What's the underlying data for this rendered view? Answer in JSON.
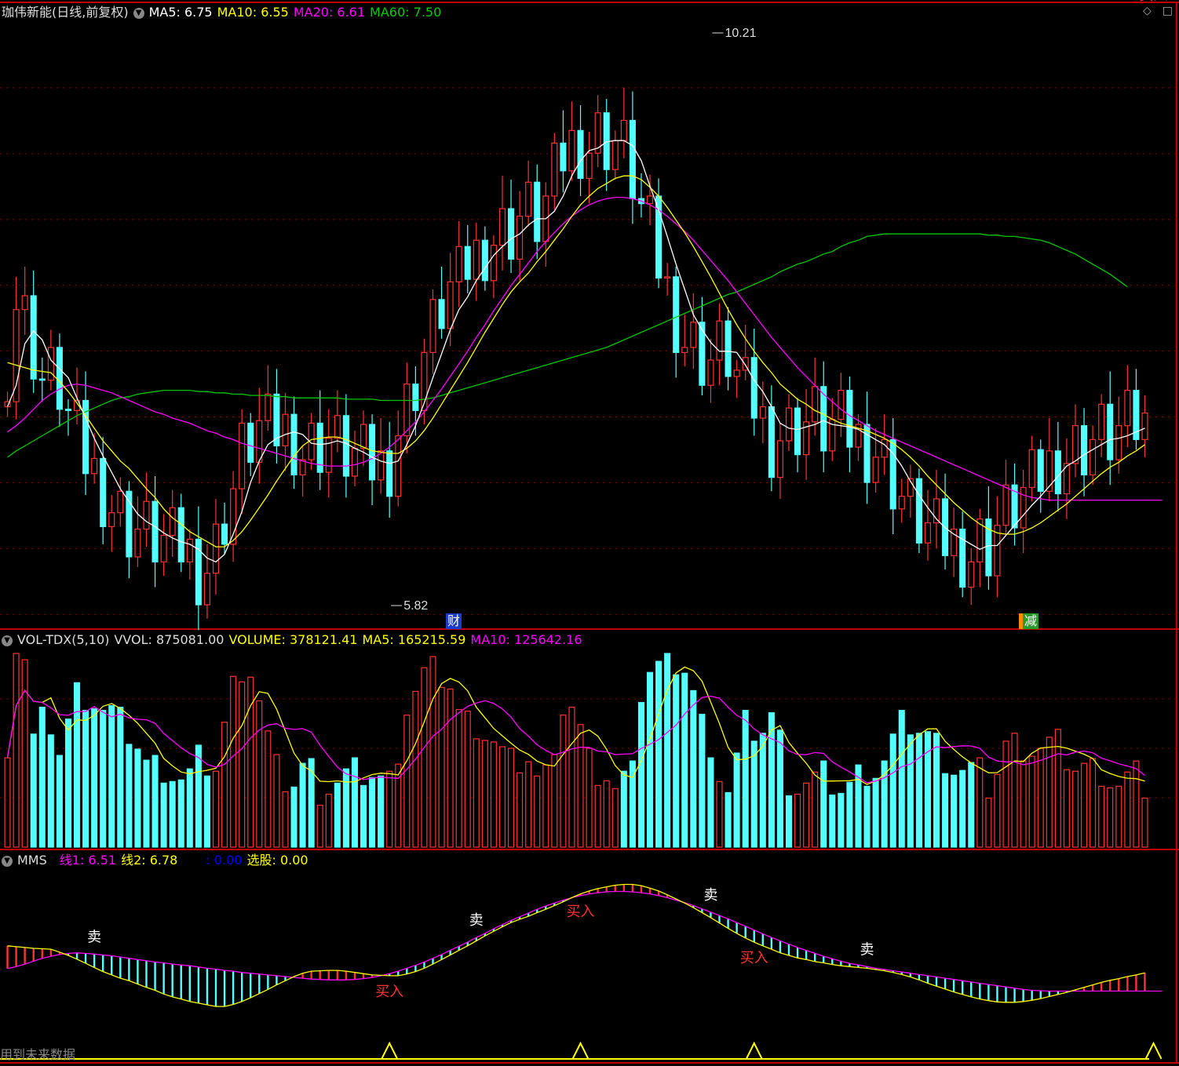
{
  "main_header": {
    "stock": "珈伟新能(日线,前复权)",
    "ma5": "MA5: 6.75",
    "ma10": "MA10: 6.55",
    "ma20": "MA20: 6.61",
    "ma60": "MA60: 7.50"
  },
  "vol_header": {
    "name": "VOL-TDX(5,10)",
    "vvol": "VVOL: 875081.00",
    "volume": "VOLUME: 378121.41",
    "ma5": "MA5: 165215.59",
    "ma10": "MA10: 125642.16"
  },
  "mms_header": {
    "name": "MMS",
    "line1": "线1: 6.51",
    "line2": "线2: 6.78",
    "blank": ": 0.00",
    "select": "选股: 0.00"
  },
  "markers": {
    "high_label": "10.21",
    "low_label": "5.82",
    "cai_badge": "财",
    "jian_badge": "减",
    "sell_label": "卖",
    "buy_label": "买入"
  },
  "footer_text": "用到未来数据",
  "window_icons": [
    "diamond-icon",
    "square-icon"
  ],
  "colors": {
    "up": "#ff3232",
    "down": "#54ffff",
    "ma5": "#ffffff",
    "ma10": "#ffff00",
    "ma20": "#ff00ff",
    "ma60": "#00c800",
    "grid": "#8b0000",
    "border": "#c00000"
  },
  "chart_data": [
    {
      "type": "candlestick",
      "title": "珈伟新能(日线,前复权)",
      "ylim": [
        5.6,
        10.4
      ],
      "annotations": [
        {
          "label": "10.21",
          "kind": "high",
          "index": 81
        },
        {
          "label": "5.82",
          "kind": "low",
          "index": 44
        }
      ],
      "series": [
        {
          "name": "MA5",
          "values": [
            7.35,
            7.52,
            7.85,
            7.95,
            7.88,
            7.72,
            7.65,
            7.58,
            7.42,
            7.26,
            7.1,
            6.96,
            6.83,
            6.7,
            6.6,
            6.5,
            6.44,
            6.4,
            6.35,
            6.31,
            6.28,
            6.26,
            6.22,
            6.15,
            6.12,
            6.18,
            6.34,
            6.52,
            6.75,
            6.92,
            7.05,
            7.1,
            7.13,
            7.15,
            7.13,
            7.06,
            7.05,
            7.06,
            7.08,
            7.06,
            7.02,
            6.99,
            6.95,
            6.92,
            6.9,
            6.92,
            7.05,
            7.2,
            7.38,
            7.58,
            7.77,
            7.96,
            8.12,
            8.22,
            8.35,
            8.45,
            8.55,
            8.62,
            8.68,
            8.72,
            8.79,
            8.84,
            8.84,
            8.9,
            9.02,
            9.18,
            9.3,
            9.38,
            9.4,
            9.45,
            9.46,
            9.46,
            9.42,
            9.3,
            9.1,
            8.91,
            8.7,
            8.48,
            8.28,
            8.08,
            7.96,
            7.86,
            7.79,
            7.79,
            7.78,
            7.68,
            7.56,
            7.47,
            7.35,
            7.22,
            7.18,
            7.17,
            7.19,
            7.21,
            7.24,
            7.21,
            7.2,
            7.19,
            7.17,
            7.13,
            7.09,
            7.05,
            6.98,
            6.88,
            6.76,
            6.65,
            6.55,
            6.46,
            6.39,
            6.34,
            6.3,
            6.26,
            6.22,
            6.25,
            6.25,
            6.33,
            6.41,
            6.49,
            6.57,
            6.64,
            6.72,
            6.8,
            6.88,
            6.92,
            6.97,
            7.01,
            7.05,
            7.09,
            7.1,
            7.12,
            7.15,
            7.18
          ]
        },
        {
          "name": "MA10",
          "values": [
            7.7,
            7.68,
            7.66,
            7.64,
            7.63,
            7.62,
            7.55,
            7.47,
            7.38,
            7.28,
            7.18,
            7.08,
            7.0,
            6.92,
            6.86,
            6.78,
            6.7,
            6.63,
            6.54,
            6.47,
            6.42,
            6.36,
            6.32,
            6.28,
            6.24,
            6.24,
            6.29,
            6.36,
            6.45,
            6.55,
            6.65,
            6.76,
            6.86,
            6.96,
            7.04,
            7.09,
            7.1,
            7.11,
            7.11,
            7.09,
            7.06,
            7.03,
            7.0,
            6.99,
            6.98,
            6.98,
            7.02,
            7.08,
            7.16,
            7.26,
            7.37,
            7.48,
            7.59,
            7.7,
            7.82,
            7.94,
            8.05,
            8.16,
            8.26,
            8.34,
            8.41,
            8.5,
            8.58,
            8.67,
            8.76,
            8.86,
            8.95,
            9.02,
            9.08,
            9.12,
            9.16,
            9.18,
            9.18,
            9.15,
            9.09,
            9.02,
            8.93,
            8.83,
            8.73,
            8.62,
            8.5,
            8.38,
            8.25,
            8.12,
            8.0,
            7.89,
            7.79,
            7.7,
            7.62,
            7.53,
            7.47,
            7.41,
            7.37,
            7.32,
            7.29,
            7.25,
            7.22,
            7.2,
            7.18,
            7.16,
            7.13,
            7.1,
            7.06,
            7.01,
            6.95,
            6.88,
            6.8,
            6.73,
            6.66,
            6.59,
            6.53,
            6.47,
            6.42,
            6.38,
            6.35,
            6.34,
            6.34,
            6.36,
            6.39,
            6.43,
            6.48,
            6.53,
            6.58,
            6.64,
            6.7,
            6.76,
            6.82,
            6.87,
            6.91,
            6.96,
            7.0,
            7.05
          ]
        },
        {
          "name": "MA20",
          "values": [
            7.15,
            7.2,
            7.26,
            7.33,
            7.4,
            7.45,
            7.49,
            7.52,
            7.53,
            7.52,
            7.5,
            7.48,
            7.46,
            7.43,
            7.4,
            7.37,
            7.34,
            7.31,
            7.29,
            7.26,
            7.24,
            7.22,
            7.19,
            7.16,
            7.14,
            7.11,
            7.09,
            7.06,
            7.04,
            7.02,
            7.0,
            6.98,
            6.96,
            6.94,
            6.92,
            6.9,
            6.89,
            6.88,
            6.88,
            6.88,
            6.89,
            6.91,
            6.94,
            6.98,
            7.03,
            7.09,
            7.16,
            7.23,
            7.31,
            7.4,
            7.49,
            7.59,
            7.69,
            7.79,
            7.9,
            8.0,
            8.11,
            8.21,
            8.31,
            8.4,
            8.49,
            8.58,
            8.66,
            8.73,
            8.8,
            8.86,
            8.91,
            8.95,
            8.98,
            9.0,
            9.01,
            9.01,
            9.0,
            8.98,
            8.95,
            8.91,
            8.86,
            8.8,
            8.74,
            8.67,
            8.59,
            8.51,
            8.43,
            8.35,
            8.26,
            8.17,
            8.08,
            7.99,
            7.9,
            7.82,
            7.74,
            7.66,
            7.59,
            7.52,
            7.45,
            7.39,
            7.33,
            7.28,
            7.24,
            7.2,
            7.16,
            7.13,
            7.1,
            7.07,
            7.04,
            7.01,
            6.98,
            6.95,
            6.92,
            6.89,
            6.86,
            6.83,
            6.8,
            6.77,
            6.74,
            6.71,
            6.68,
            6.65,
            6.63,
            6.62,
            6.61,
            6.61,
            6.61,
            6.61,
            6.61,
            6.61,
            6.61,
            6.61,
            6.61,
            6.61,
            6.61,
            6.61,
            6.61,
            6.61
          ]
        },
        {
          "name": "MA60",
          "values": [
            6.95,
            7.0,
            7.04,
            7.08,
            7.12,
            7.16,
            7.2,
            7.24,
            7.28,
            7.31,
            7.34,
            7.37,
            7.4,
            7.42,
            7.43,
            7.45,
            7.46,
            7.47,
            7.48,
            7.48,
            7.48,
            7.48,
            7.47,
            7.47,
            7.46,
            7.46,
            7.45,
            7.45,
            7.44,
            7.44,
            7.44,
            7.43,
            7.43,
            7.42,
            7.42,
            7.42,
            7.42,
            7.42,
            7.42,
            7.41,
            7.41,
            7.41,
            7.41,
            7.4,
            7.4,
            7.4,
            7.4,
            7.4,
            7.41,
            7.42,
            7.44,
            7.46,
            7.48,
            7.5,
            7.52,
            7.54,
            7.56,
            7.58,
            7.6,
            7.62,
            7.64,
            7.66,
            7.68,
            7.7,
            7.72,
            7.74,
            7.76,
            7.78,
            7.8,
            7.82,
            7.85,
            7.88,
            7.91,
            7.94,
            7.97,
            8.0,
            8.03,
            8.06,
            8.09,
            8.12,
            8.15,
            8.18,
            8.21,
            8.24,
            8.26,
            8.29,
            8.32,
            8.35,
            8.38,
            8.42,
            8.45,
            8.48,
            8.5,
            8.53,
            8.56,
            8.58,
            8.62,
            8.65,
            8.67,
            8.7,
            8.71,
            8.72,
            8.72,
            8.72,
            8.72,
            8.72,
            8.72,
            8.72,
            8.72,
            8.72,
            8.72,
            8.72,
            8.72,
            8.71,
            8.71,
            8.7,
            8.7,
            8.69,
            8.68,
            8.67,
            8.65,
            8.62,
            8.59,
            8.56,
            8.52,
            8.48,
            8.44,
            8.4,
            8.35,
            8.3
          ]
        }
      ]
    },
    {
      "type": "bar",
      "title": "VOL-TDX(5,10)",
      "series": [
        {
          "name": "VOLUME"
        },
        {
          "name": "MA5"
        },
        {
          "name": "MA10"
        }
      ]
    },
    {
      "type": "line",
      "title": "MMS",
      "series": [
        {
          "name": "线1"
        },
        {
          "name": "线2"
        }
      ]
    }
  ]
}
